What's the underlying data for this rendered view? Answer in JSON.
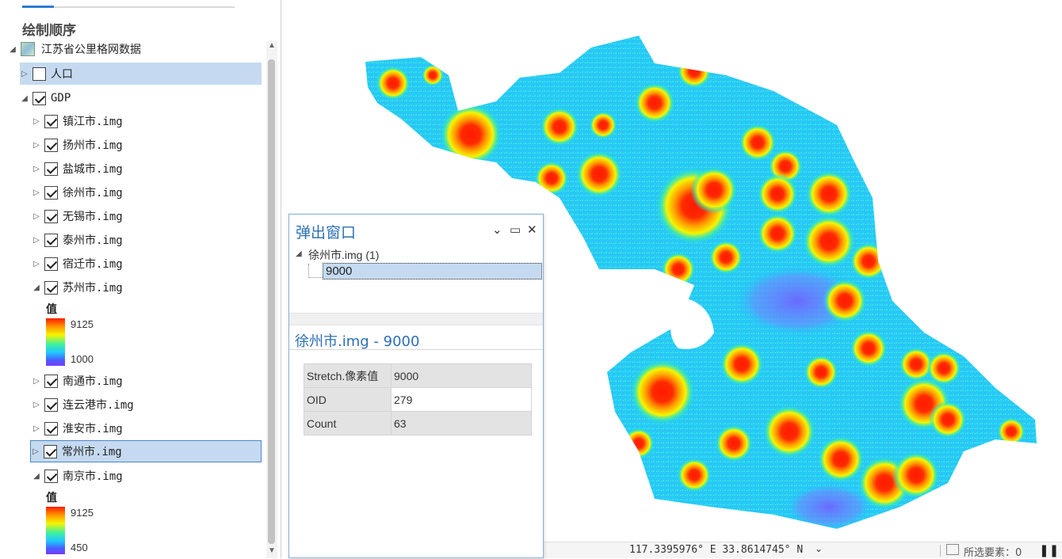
{
  "toc": {
    "title": "绘制顺序",
    "map_name": "江苏省公里格网数据",
    "layers": [
      {
        "label": "人口",
        "checked": false,
        "expanded": false,
        "selected": true
      },
      {
        "label": "GDP",
        "checked": true,
        "expanded": true
      },
      {
        "label": "镇江市.img",
        "checked": true,
        "expanded": false
      },
      {
        "label": "扬州市.img",
        "checked": true,
        "expanded": false
      },
      {
        "label": "盐城市.img",
        "checked": true,
        "expanded": false
      },
      {
        "label": "徐州市.img",
        "checked": true,
        "expanded": false
      },
      {
        "label": "无锡市.img",
        "checked": true,
        "expanded": false
      },
      {
        "label": "泰州市.img",
        "checked": true,
        "expanded": false
      },
      {
        "label": "宿迁市.img",
        "checked": true,
        "expanded": false
      },
      {
        "label": "苏州市.img",
        "checked": true,
        "expanded": true
      },
      {
        "label": "南通市.img",
        "checked": true,
        "expanded": false
      },
      {
        "label": "连云港市.img",
        "checked": true,
        "expanded": false
      },
      {
        "label": "淮安市.img",
        "checked": true,
        "expanded": false
      },
      {
        "label": "常州市.img",
        "checked": true,
        "expanded": false,
        "selected": true
      },
      {
        "label": "南京市.img",
        "checked": true,
        "expanded": true
      }
    ],
    "legend_suzhou": {
      "title": "值",
      "max": "9125",
      "min": "1000"
    },
    "legend_nanjing": {
      "title": "值",
      "max": "9125",
      "min": "450"
    }
  },
  "popup": {
    "title": "弹出窗口",
    "layer_entry": "徐州市.img (1)",
    "feature_entry": "9000",
    "detail_title": "徐州市.img - 9000",
    "fields": [
      {
        "key": "Stretch.像素值",
        "value": "9000"
      },
      {
        "key": "OID",
        "value": "279"
      },
      {
        "key": "Count",
        "value": "63"
      }
    ]
  },
  "status": {
    "coordinates": "117.3395976° E 33.8614745° N",
    "selected_features": "所选要素：0"
  },
  "colors": {
    "accent": "#2b7bd6",
    "selection": "#c5daf0",
    "ramp": [
      "#ff1a00",
      "#ff9a00",
      "#f5f500",
      "#3cf0a0",
      "#20c8ff",
      "#4a5cff"
    ]
  }
}
